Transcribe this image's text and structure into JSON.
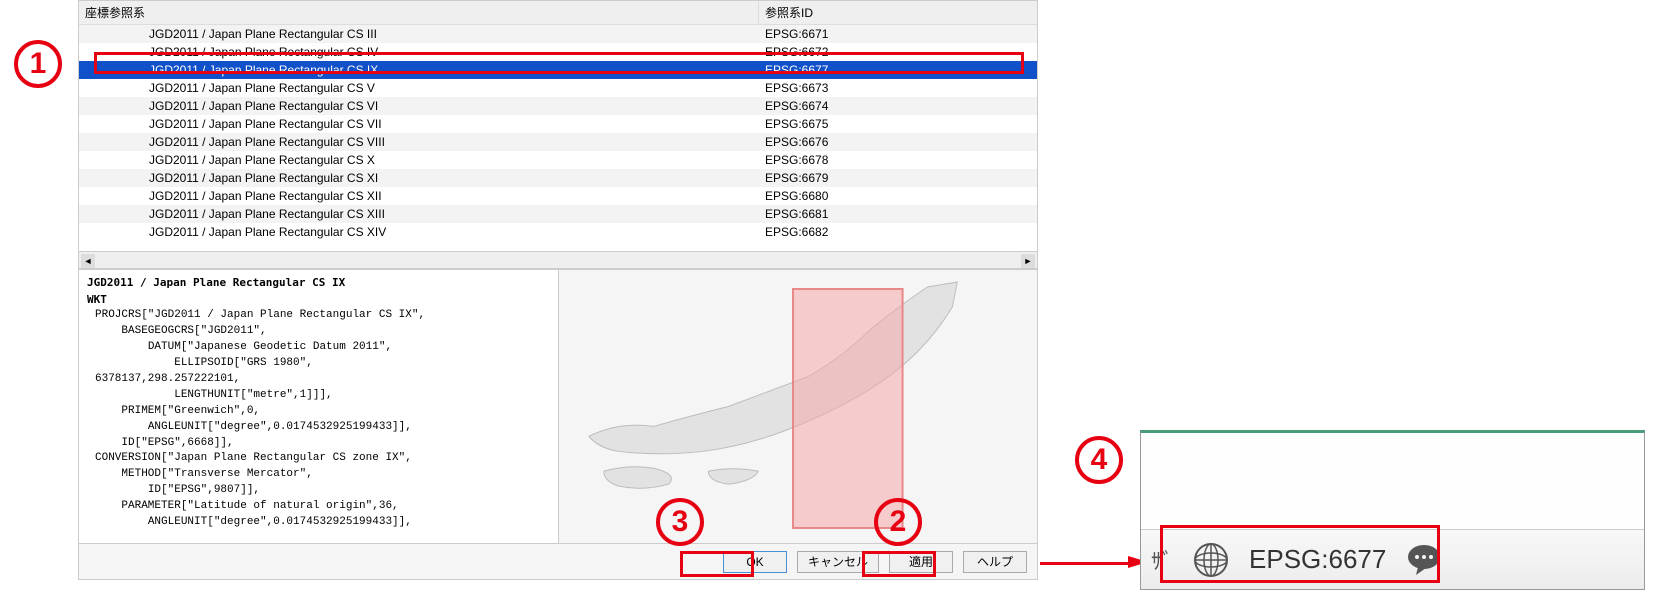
{
  "headers": {
    "crs": "座標参照系",
    "id": "参照系ID"
  },
  "rows": [
    {
      "name": "JGD2011 / Japan Plane Rectangular CS III",
      "id": "EPSG:6671",
      "selected": false
    },
    {
      "name": "JGD2011 / Japan Plane Rectangular CS IV",
      "id": "EPSG:6672",
      "selected": false
    },
    {
      "name": "JGD2011 / Japan Plane Rectangular CS IX",
      "id": "EPSG:6677",
      "selected": true
    },
    {
      "name": "JGD2011 / Japan Plane Rectangular CS V",
      "id": "EPSG:6673",
      "selected": false
    },
    {
      "name": "JGD2011 / Japan Plane Rectangular CS VI",
      "id": "EPSG:6674",
      "selected": false
    },
    {
      "name": "JGD2011 / Japan Plane Rectangular CS VII",
      "id": "EPSG:6675",
      "selected": false
    },
    {
      "name": "JGD2011 / Japan Plane Rectangular CS VIII",
      "id": "EPSG:6676",
      "selected": false
    },
    {
      "name": "JGD2011 / Japan Plane Rectangular CS X",
      "id": "EPSG:6678",
      "selected": false
    },
    {
      "name": "JGD2011 / Japan Plane Rectangular CS XI",
      "id": "EPSG:6679",
      "selected": false
    },
    {
      "name": "JGD2011 / Japan Plane Rectangular CS XII",
      "id": "EPSG:6680",
      "selected": false
    },
    {
      "name": "JGD2011 / Japan Plane Rectangular CS XIII",
      "id": "EPSG:6681",
      "selected": false
    },
    {
      "name": "JGD2011 / Japan Plane Rectangular CS XIV",
      "id": "EPSG:6682",
      "selected": false
    }
  ],
  "wkt": {
    "title": "JGD2011 / Japan Plane Rectangular CS IX",
    "label": "WKT",
    "content": "PROJCRS[\"JGD2011 / Japan Plane Rectangular CS IX\",\n    BASEGEOGCRS[\"JGD2011\",\n        DATUM[\"Japanese Geodetic Datum 2011\",\n            ELLIPSOID[\"GRS 1980\",\n6378137,298.257222101,\n            LENGTHUNIT[\"metre\",1]]],\n    PRIMEM[\"Greenwich\",0,\n        ANGLEUNIT[\"degree\",0.0174532925199433]],\n    ID[\"EPSG\",6668]],\nCONVERSION[\"Japan Plane Rectangular CS zone IX\",\n    METHOD[\"Transverse Mercator\",\n        ID[\"EPSG\",9807]],\n    PARAMETER[\"Latitude of natural origin\",36,\n        ANGLEUNIT[\"degree\",0.0174532925199433]],"
  },
  "buttons": {
    "ok": "OK",
    "cancel": "キャンセル",
    "apply": "適用",
    "help": "ヘルプ"
  },
  "status": {
    "epsg": "EPSG:6677"
  },
  "annotations": {
    "n1": "1",
    "n2": "2",
    "n3": "3",
    "n4": "4"
  }
}
